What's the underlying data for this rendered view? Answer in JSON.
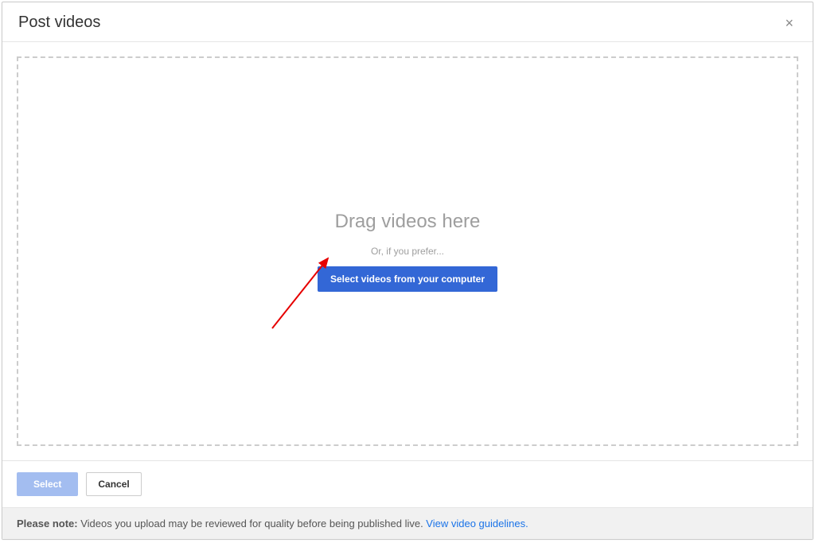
{
  "modal": {
    "title": "Post videos",
    "close_glyph": "×"
  },
  "dropzone": {
    "drag_text": "Drag videos here",
    "or_text": "Or, if you prefer...",
    "select_button_label": "Select videos from your computer"
  },
  "footer": {
    "select_label": "Select",
    "cancel_label": "Cancel"
  },
  "note": {
    "bold": "Please note:",
    "text": " Videos you upload may be reviewed for quality before being published live. ",
    "link": "View video guidelines."
  }
}
